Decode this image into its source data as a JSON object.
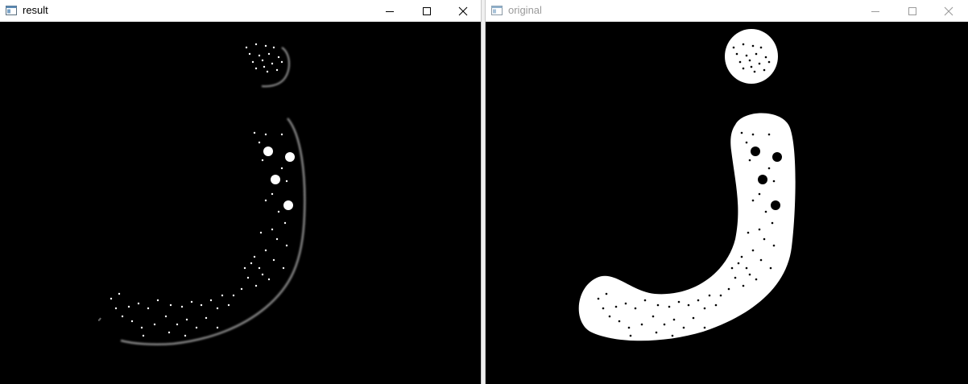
{
  "windows": {
    "result": {
      "title": "result",
      "active": true
    },
    "original": {
      "title": "original",
      "active": false
    }
  },
  "controls": {
    "minimize_icon": "minimize-icon",
    "maximize_icon": "maximize-icon",
    "close_icon": "close-icon"
  },
  "colors": {
    "titlebar_bg": "#ffffff",
    "canvas_bg": "#000000",
    "title_active": "#000000",
    "title_inactive": "#9a9a9a"
  }
}
